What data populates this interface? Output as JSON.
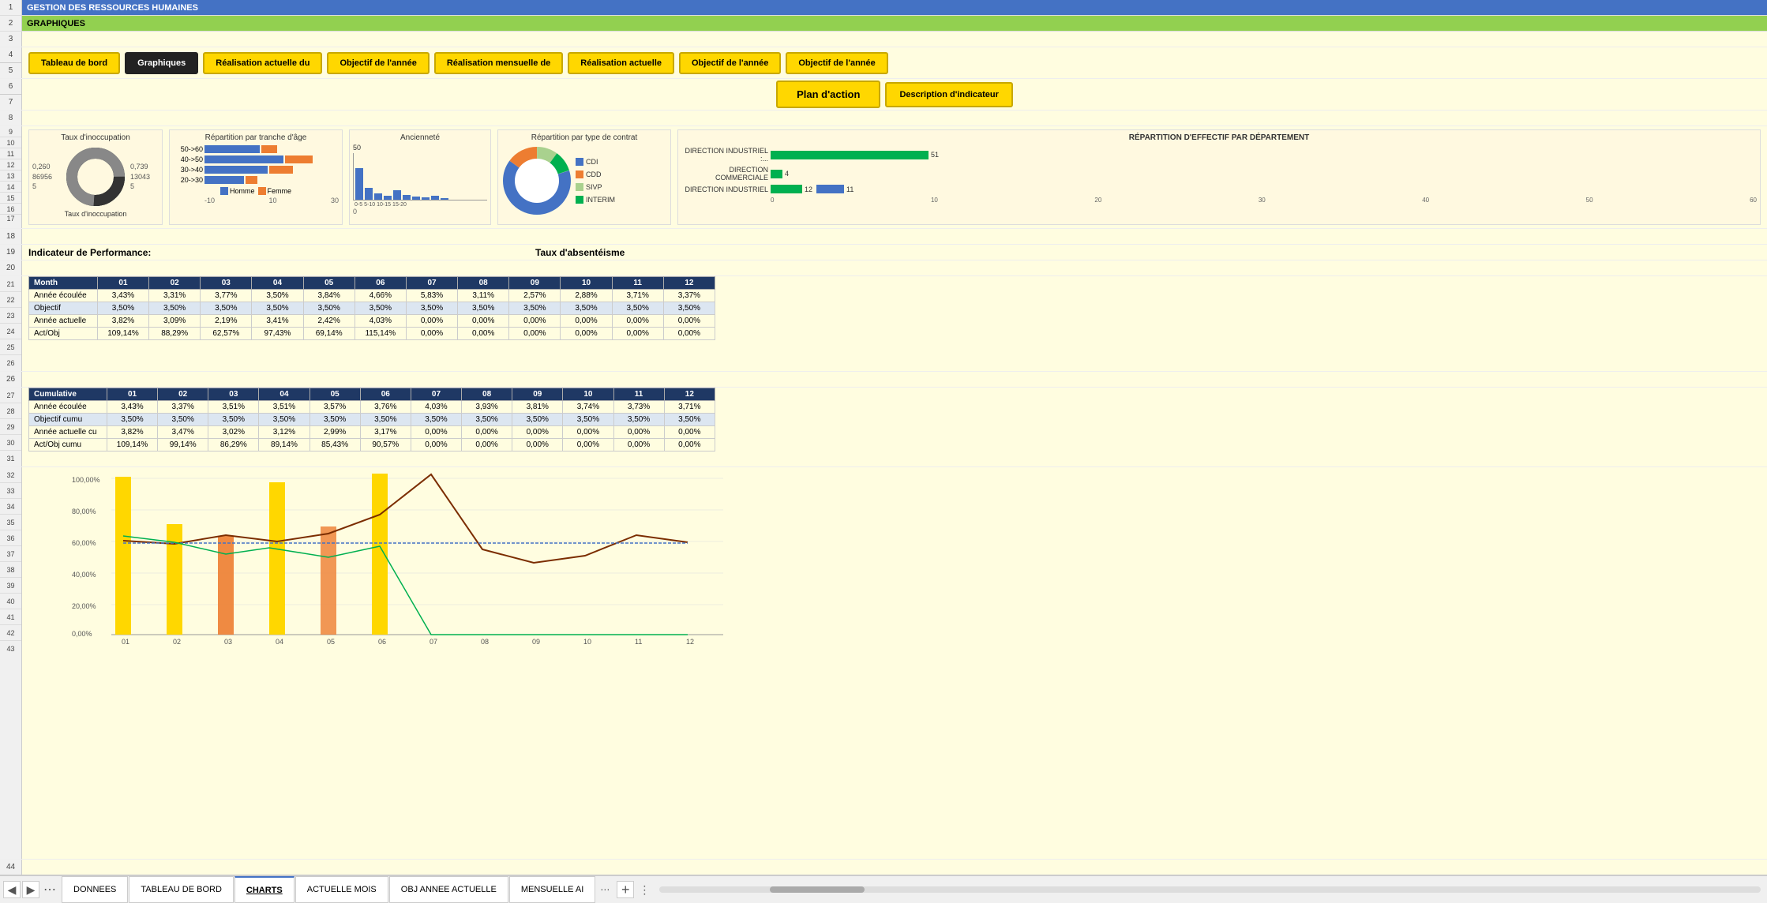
{
  "title1": "GESTION DES RESSOURCES HUMAINES",
  "title2": "GRAPHIQUES",
  "nav_buttons": {
    "tableau_de_bord": "Tableau de bord",
    "graphiques": "Graphiques",
    "realisation_actuelle": "Réalisation actuelle du",
    "objectif_annee": "Objectif de l'année",
    "realisation_mensuelle": "Réalisation mensuelle de",
    "realisation_actuelle2": "Réalisation actuelle",
    "objectif_annee2": "Objectif de l'année",
    "objectif_annee3": "Objectif de l'année",
    "plan_action": "Plan d'action",
    "description_indicateur": "Description d'indicateur"
  },
  "chart_titles": {
    "taux_inocupation": "Taux d'inoccupation",
    "repartition_age": "Répartition par tranche d'âge",
    "anciennete": "Ancienneté",
    "repartition_contrat": "Répartition par type de contrat",
    "repartition_dept": "RÉPARTITION D'EFFECTIF PAR DÉPARTEMENT"
  },
  "donut_values": {
    "val1": "0,260",
    "val2": "86956",
    "val3": "5",
    "val4": "0,739",
    "val5": "13043",
    "val6": "5",
    "label": "Taux d'inoccupation"
  },
  "age_legend": {
    "homme": "Homme",
    "femme": "Femme"
  },
  "age_ranges": [
    "50->60",
    "40->50",
    "30->40",
    "20->30"
  ],
  "contrat_legend": {
    "cdi": "CDI",
    "cdd": "CDD",
    "sivp": "SIVP",
    "interim": "INTERIM"
  },
  "dept_data": [
    {
      "label": "DIRECTION INDUSTRIEL :...",
      "value": 51,
      "bar": 51
    },
    {
      "label": "DIRECTION COMMERCIALE",
      "value": 4,
      "bar": 4
    },
    {
      "label": "DIRECTION INDUSTRIEL",
      "value": 12,
      "bar": 12,
      "val2": 11
    }
  ],
  "dept_axis": "0  10  20  30  40  50  60",
  "perf_title": "Indicateur de Performance:",
  "absenteisme_title": "Taux d'absentéisme",
  "table_monthly": {
    "headers": [
      "Month",
      "01",
      "02",
      "03",
      "04",
      "05",
      "06",
      "07",
      "08",
      "09",
      "10",
      "11",
      "12"
    ],
    "rows": [
      {
        "label": "Année écoulée",
        "class": "row-annee-ecoule",
        "values": [
          "3,43%",
          "3,31%",
          "3,77%",
          "3,50%",
          "3,84%",
          "4,66%",
          "5,83%",
          "3,11%",
          "2,57%",
          "2,88%",
          "3,71%",
          "3,37%"
        ]
      },
      {
        "label": "Objectif",
        "class": "row-objectif",
        "values": [
          "3,50%",
          "3,50%",
          "3,50%",
          "3,50%",
          "3,50%",
          "3,50%",
          "3,50%",
          "3,50%",
          "3,50%",
          "3,50%",
          "3,50%",
          "3,50%"
        ]
      },
      {
        "label": "Année actuelle",
        "class": "row-annee-actuelle",
        "values": [
          "3,82%",
          "3,09%",
          "2,19%",
          "3,41%",
          "2,42%",
          "4,03%",
          "0,00%",
          "0,00%",
          "0,00%",
          "0,00%",
          "0,00%",
          "0,00%"
        ]
      },
      {
        "label": "Act/Obj",
        "class": "row-act-obj",
        "values": [
          "109,14%",
          "88,29%",
          "62,57%",
          "97,43%",
          "69,14%",
          "115,14%",
          "0,00%",
          "0,00%",
          "0,00%",
          "0,00%",
          "0,00%",
          "0,00%"
        ]
      }
    ]
  },
  "table_cumulative": {
    "headers": [
      "Cumulative",
      "01",
      "02",
      "03",
      "04",
      "05",
      "06",
      "07",
      "08",
      "09",
      "10",
      "11",
      "12"
    ],
    "rows": [
      {
        "label": "Année écoulée",
        "class": "row-annee-ecoule",
        "values": [
          "3,43%",
          "3,37%",
          "3,51%",
          "3,51%",
          "3,57%",
          "3,76%",
          "4,03%",
          "3,93%",
          "3,81%",
          "3,74%",
          "3,73%",
          "3,71%"
        ]
      },
      {
        "label": "Objectif cumu",
        "class": "row-obj-cum",
        "values": [
          "3,50%",
          "3,50%",
          "3,50%",
          "3,50%",
          "3,50%",
          "3,50%",
          "3,50%",
          "3,50%",
          "3,50%",
          "3,50%",
          "3,50%",
          "3,50%"
        ]
      },
      {
        "label": "Année actuelle cu",
        "class": "row-annee-actuelle",
        "values": [
          "3,82%",
          "3,47%",
          "3,02%",
          "3,12%",
          "2,99%",
          "3,17%",
          "0,00%",
          "0,00%",
          "0,00%",
          "0,00%",
          "0,00%",
          "0,00%"
        ]
      },
      {
        "label": "Act/Obj cumu",
        "class": "row-act-obj",
        "values": [
          "109,14%",
          "99,14%",
          "86,29%",
          "89,14%",
          "85,43%",
          "90,57%",
          "0,00%",
          "0,00%",
          "0,00%",
          "0,00%",
          "0,00%",
          "0,00%"
        ]
      }
    ]
  },
  "bottom_chart_labels": [
    "01",
    "02",
    "03",
    "04",
    "05",
    "06",
    "07",
    "08",
    "09",
    "10",
    "11",
    "12"
  ],
  "bottom_chart_yaxis": [
    "100,00%",
    "80,00%",
    "60,00%",
    "40,00%",
    "20,00%",
    "0,00%"
  ],
  "tabs": [
    {
      "label": "DONNEES",
      "active": false
    },
    {
      "label": "TABLEAU DE BORD",
      "active": false
    },
    {
      "label": "CHARTS",
      "active": true
    },
    {
      "label": "ACTUELLE MOIS",
      "active": false
    },
    {
      "label": "OBJ ANNEE ACTUELLE",
      "active": false
    },
    {
      "label": "MENSUELLE AI",
      "active": false
    }
  ],
  "colors": {
    "header_blue": "#4472c4",
    "header_green": "#92d050",
    "yellow": "#ffd700",
    "dark": "#1f3864",
    "bg": "#fffde0"
  }
}
